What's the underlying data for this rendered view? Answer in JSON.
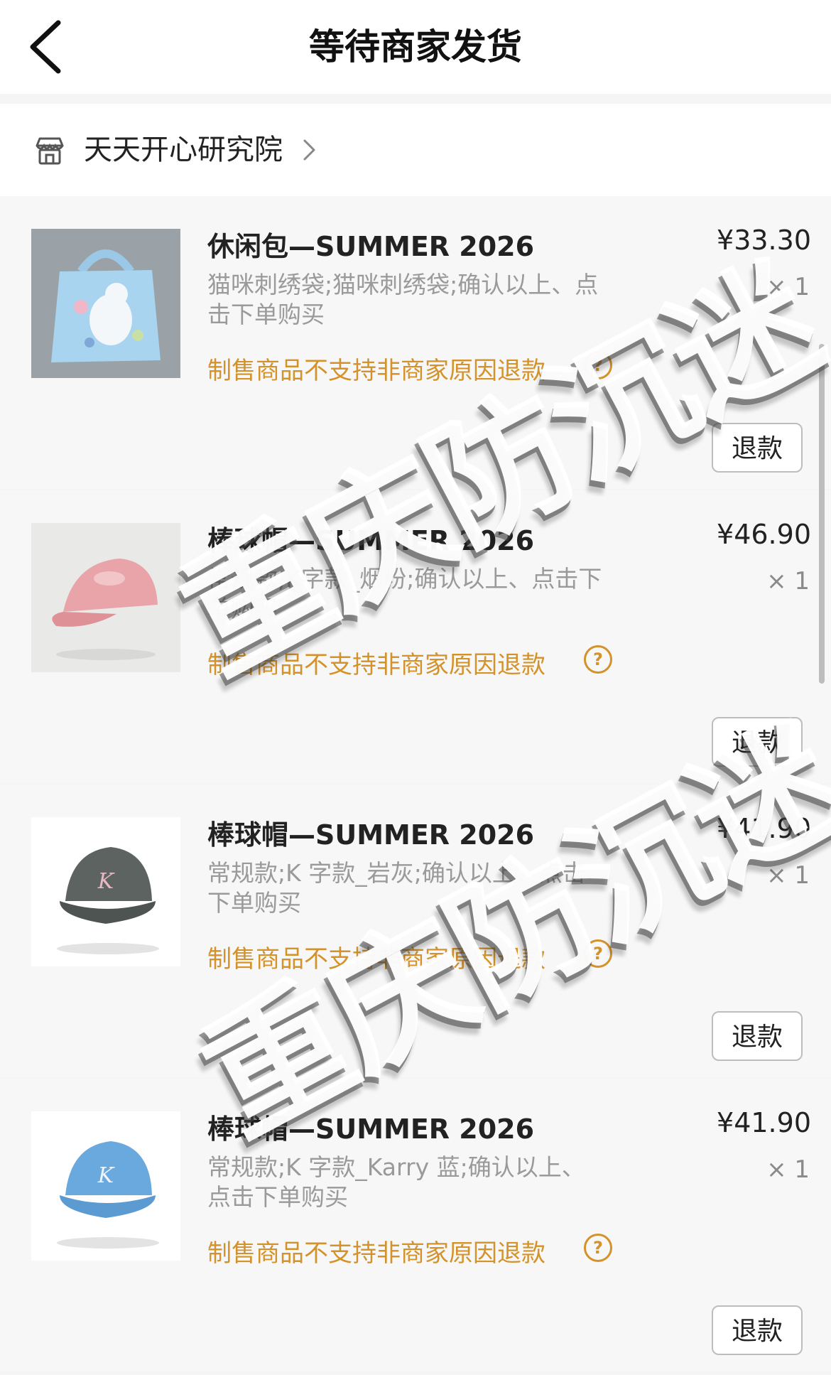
{
  "header": {
    "title": "等待商家发货",
    "back_icon": "chevron-left-icon"
  },
  "shop": {
    "name": "天天开心研究院",
    "icon": "store-icon",
    "arrow_icon": "chevron-right-icon"
  },
  "items": [
    {
      "name": "休闲包—SUMMER 2026",
      "price": "¥33.30",
      "qty": "× 1",
      "spec": "猫咪刺绣袋;猫咪刺绣袋;确认以上、点击下单购买",
      "notice": "制售商品不支持非商家原因退款",
      "refund_label": "退款"
    },
    {
      "name": "棒球帽—SUMMER 2026",
      "price": "¥46.90",
      "qty": "× 1",
      "spec": "常规款;K字款_烟粉;确认以上、点击下单购买",
      "notice": "制售商品不支持非商家原因退款",
      "refund_label": "退款"
    },
    {
      "name": "棒球帽—SUMMER 2026",
      "price": "¥41.90",
      "qty": "× 1",
      "spec": "常规款;K 字款_岩灰;确认以上、点击下单购买",
      "notice": "制售商品不支持非商家原因退款",
      "refund_label": "退款"
    },
    {
      "name": "棒球帽—SUMMER 2026",
      "price": "¥41.90",
      "qty": "× 1",
      "spec": "常规款;K 字款_Karry 蓝;确认以上、点击下单购买",
      "notice": "制售商品不支持非商家原因退款",
      "refund_label": "退款"
    }
  ],
  "watermark": {
    "text": "重庆防沉迷"
  },
  "colors": {
    "notice": "#d4922a",
    "price": "#222222",
    "secondary": "#9a9a9a"
  }
}
